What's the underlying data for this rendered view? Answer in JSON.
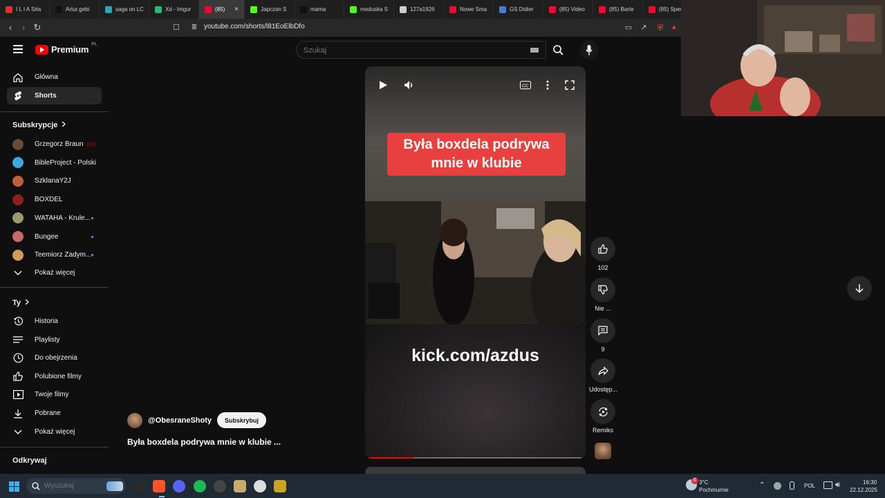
{
  "browser": {
    "tabs": [
      {
        "title": "I L I A S#a",
        "color": "#e03030"
      },
      {
        "title": "Artur.gebi",
        "color": "#111111"
      },
      {
        "title": "saga on LC",
        "color": "#2aa6b8"
      },
      {
        "title": "Xd - Imgur",
        "color": "#2bb673"
      },
      {
        "title": "(85)",
        "color": "#ff0033",
        "active": true
      },
      {
        "title": "Japczan S",
        "color": "#53fc18"
      },
      {
        "title": "mama",
        "color": "#111111"
      },
      {
        "title": "meduska S",
        "color": "#53fc18"
      },
      {
        "title": "127a1926",
        "color": "#cccccc"
      },
      {
        "title": "Nowe Sma",
        "color": "#ff0033"
      },
      {
        "title": "GS Didier",
        "color": "#4a7bd0"
      },
      {
        "title": "(85) Video",
        "color": "#ff0033"
      },
      {
        "title": "(85) Barte",
        "color": "#ff0033"
      },
      {
        "title": "(85) Spec",
        "color": "#ff0033"
      }
    ],
    "url": "youtube.com/shorts/l81EoElbDfo"
  },
  "header": {
    "logo": "Premium",
    "logo_region": "PL",
    "search_placeholder": "Szukaj"
  },
  "sidebar": {
    "main": [
      {
        "label": "Główna",
        "icon": "home-icon"
      },
      {
        "label": "Shorts",
        "icon": "shorts-icon",
        "active": true
      }
    ],
    "subscriptions_title": "Subskrypcje",
    "subscriptions": [
      {
        "name": "Grzegorz Braun",
        "color": "#6b4a3a",
        "live": true
      },
      {
        "name": "BibleProject - Polski",
        "color": "#39a9e0"
      },
      {
        "name": "SzklanaY2J",
        "color": "#c0603a"
      },
      {
        "name": "BOXDEL",
        "color": "#8a1f1f"
      },
      {
        "name": "WATAHA - Krule...",
        "color": "#9a9a6a",
        "dot": true
      },
      {
        "name": "Bungee",
        "color": "#c96a6a",
        "dot": true
      },
      {
        "name": "Teemiorz Zadym...",
        "color": "#d49a5a",
        "dot": true
      }
    ],
    "show_more": "Pokaż więcej",
    "you_title": "Ty",
    "you": [
      {
        "label": "Historia",
        "icon": "history-icon"
      },
      {
        "label": "Playlisty",
        "icon": "playlist-icon"
      },
      {
        "label": "Do obejrzenia",
        "icon": "clock-icon"
      },
      {
        "label": "Polubione filmy",
        "icon": "thumbs-up-icon"
      },
      {
        "label": "Twoje filmy",
        "icon": "video-icon"
      },
      {
        "label": "Pobrane",
        "icon": "download-icon"
      }
    ],
    "show_more_2": "Pokaż więcej",
    "explore_title": "Odkrywaj"
  },
  "video": {
    "caption": "Była boxdela podrywa mnie w klubie",
    "overlay_text": "kick.com/azdus",
    "progress": 0.21
  },
  "actions": {
    "like_count": "102",
    "dislike_label": "Nie ...",
    "comments_count": "9",
    "share_label": "Udostęp...",
    "remix_label": "Remiks"
  },
  "meta": {
    "channel": "@ObesraneShoty",
    "subscribe": "Subskrybuj",
    "title": "Była boxdela podrywa mnie w klubie ..."
  },
  "taskbar": {
    "search_placeholder": "Wyszukaj",
    "weather_temp": "3°C",
    "weather_desc": "Pochmurnie",
    "weather_badge": "6",
    "lang": "POL",
    "time": "16:30",
    "date": "22.12.2025"
  }
}
